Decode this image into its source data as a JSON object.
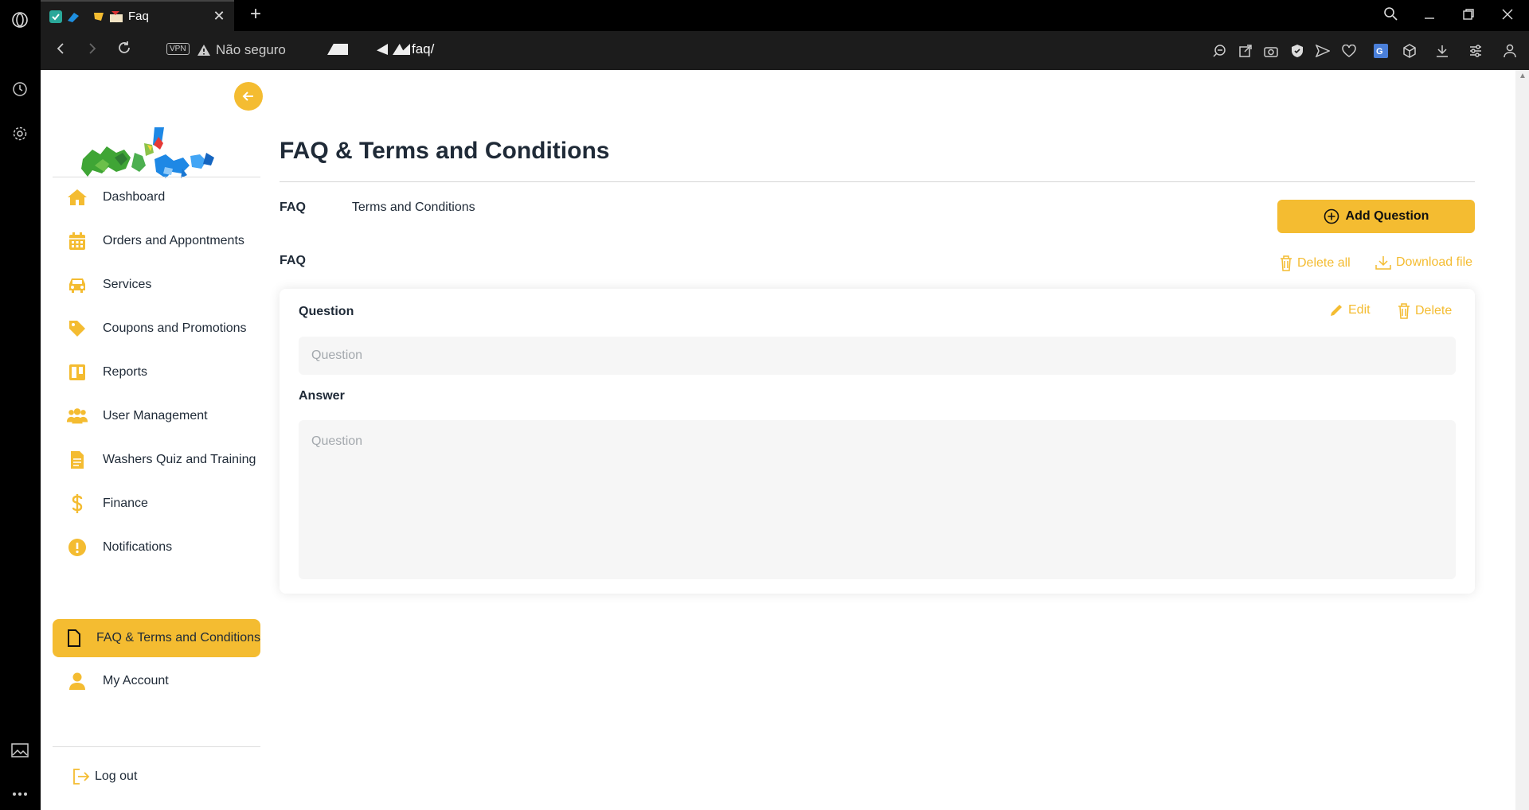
{
  "browser": {
    "tab_title": "Faq",
    "new_tab_symbol": "+",
    "security_label": "Não seguro",
    "vpn_label": "VPN",
    "url_path": "faq/"
  },
  "sidebar": {
    "items": [
      {
        "label": "Dashboard",
        "icon": "home-icon"
      },
      {
        "label": "Orders and Appontments",
        "icon": "calendar-icon"
      },
      {
        "label": "Services",
        "icon": "car-icon"
      },
      {
        "label": "Coupons and Promotions",
        "icon": "tag-icon"
      },
      {
        "label": "Reports",
        "icon": "columns-icon"
      },
      {
        "label": "User Management",
        "icon": "users-icon"
      },
      {
        "label": "Washers Quiz and Training",
        "icon": "file-icon"
      },
      {
        "label": "Finance",
        "icon": "dollar-icon"
      },
      {
        "label": "Notifications",
        "icon": "alert-icon"
      },
      {
        "label": "FAQ & Terms and Conditions",
        "icon": "document-icon",
        "active": true
      },
      {
        "label": "My Account",
        "icon": "user-icon"
      }
    ],
    "logout_label": "Log out"
  },
  "main": {
    "title": "FAQ & Terms and Conditions",
    "tabs": [
      "FAQ",
      "Terms and Conditions"
    ],
    "add_button_label": "Add Question",
    "section_label": "FAQ",
    "delete_all_label": "Delete all",
    "download_label": "Download file",
    "card": {
      "question_label": "Question",
      "question_placeholder": "Question",
      "answer_label": "Answer",
      "answer_placeholder": "Question",
      "edit_label": "Edit",
      "delete_label": "Delete"
    }
  },
  "colors": {
    "accent": "#f4bc31",
    "text": "#1f2a37"
  }
}
